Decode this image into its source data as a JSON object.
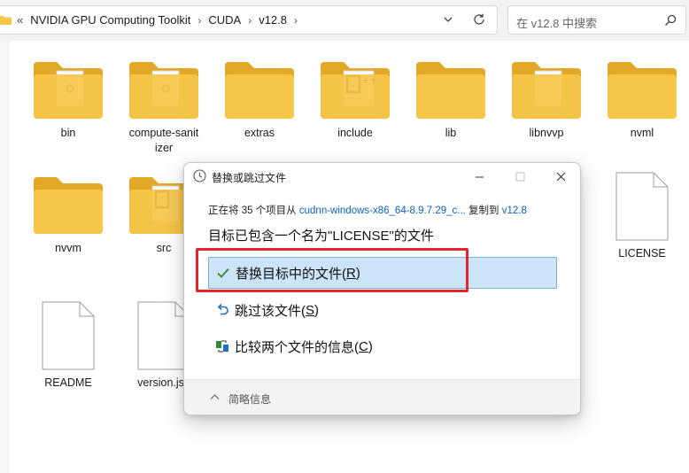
{
  "address_bar": {
    "overflow": "«",
    "crumbs": [
      "NVIDIA GPU Computing Toolkit",
      "CUDA",
      "v12.8"
    ],
    "separator": "›",
    "search_placeholder": "在 v12.8 中搜索"
  },
  "items": [
    {
      "label": "bin",
      "kind": "folder",
      "overlay": "exe"
    },
    {
      "label": "compute-sanit izer",
      "kind": "folder",
      "overlay": "exe"
    },
    {
      "label": "extras",
      "kind": "folder",
      "overlay": "none"
    },
    {
      "label": "include",
      "kind": "folder",
      "overlay": "cpp"
    },
    {
      "label": "lib",
      "kind": "folder",
      "overlay": "none"
    },
    {
      "label": "libnvvp",
      "kind": "folder",
      "overlay": "doc"
    },
    {
      "label": "nvml",
      "kind": "folder",
      "overlay": "none"
    },
    {
      "label": "nvvm",
      "kind": "folder",
      "overlay": "none"
    },
    {
      "label": "src",
      "kind": "folder",
      "overlay": "c"
    },
    {
      "label": "LICENSE",
      "kind": "file"
    },
    {
      "label": "README",
      "kind": "file"
    },
    {
      "label": "version.jso",
      "kind": "file"
    }
  ],
  "dialog": {
    "title": "替换或跳过文件",
    "info_prefix": "正在将 35 个项目从",
    "info_source": "cudnn-windows-x86_64-8.9.7.29_c...",
    "info_mid": "复制到",
    "info_dest": "v12.8",
    "heading": "目标已包含一个名为\"LICENSE\"的文件",
    "options": [
      {
        "text": "替换目标中的文件(",
        "key": "R",
        "suffix": ")",
        "icon": "check-icon",
        "selected": true
      },
      {
        "text": "跳过该文件(",
        "key": "S",
        "suffix": ")",
        "icon": "undo-icon",
        "selected": false
      },
      {
        "text": "比较两个文件的信息(",
        "key": "C",
        "suffix": ")",
        "icon": "compare-icon",
        "selected": false
      }
    ],
    "footer": "简略信息"
  },
  "colors": {
    "folder": "#f6c649",
    "folder_back": "#e3a825",
    "selection": "#cce4f7",
    "link": "#0a63c2",
    "highlight": "#e0262c",
    "check": "#2e8b3a"
  }
}
